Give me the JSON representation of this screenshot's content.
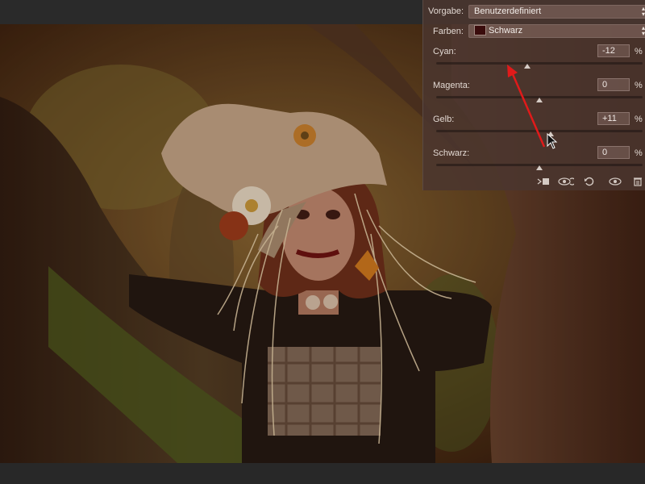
{
  "panel": {
    "preset_label": "Vorgabe:",
    "preset_value": "Benutzerdefiniert",
    "colors_label": "Farben:",
    "colors_value": "Schwarz",
    "swatch_color": "#3a0c0c",
    "sliders": [
      {
        "label": "Cyan:",
        "value": "-12",
        "unit": "%",
        "level": 0.44
      },
      {
        "label": "Magenta:",
        "value": "0",
        "unit": "%",
        "level": 0.5
      },
      {
        "label": "Gelb:",
        "value": "+11",
        "unit": "%",
        "level": 0.555
      },
      {
        "label": "Schwarz:",
        "value": "0",
        "unit": "%",
        "level": 0.5
      }
    ],
    "icons": [
      "clip-to-layer-icon",
      "view-previous-state-icon",
      "reset-icon",
      "visibility-icon",
      "delete-icon"
    ]
  },
  "annotation": {
    "arrow_color": "#e01a1a"
  }
}
